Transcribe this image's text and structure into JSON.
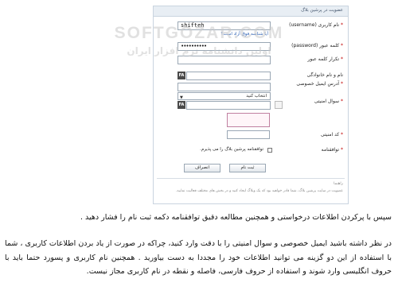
{
  "watermark": {
    "line1": "SOFTGOZAR.COM",
    "line2": "اولین دانشنامه نرم افزار ایران"
  },
  "form": {
    "title": "عضویت در پرشین بلاگ",
    "username_label": "نام کاربری (username)",
    "username_value": "shifteh",
    "availability_link": "آیا شناسه فوق آزاد است؟",
    "password_label": "کلمه عبور (password)",
    "password_value": "••••••••••",
    "repeat_password_label": "تکرار کلمه عبور",
    "fullname_label": "نام و نام خانوادگی",
    "email_label": "آدرس ایمیل خصوصی",
    "security_question_label": "سوال امنیتی",
    "security_question_selected": "انتخاب کنید",
    "security_answer_lang": "FA",
    "fullname_lang": "FA",
    "captcha_label": "کد امنیتی",
    "agreement_label": "توافقنامه",
    "agreement_text": "توافقنامه پرشین بلاگ را می پذیرم.",
    "submit_label": "ثبت نام",
    "cancel_label": "انصراف",
    "footer_heading": "راهنما",
    "footer_note": "عضویت در سایت پرشین بلاگ، شما قادر خواهید بود که یک وبلاگ ایجاد کنید و در بخش های مختلف فعالیت نمایید."
  },
  "article": {
    "para1": "سپس با پرکردن اطلاعات درخواستی و همچنین مطالعه دقیق توافقنامه دکمه ثبت نام را فشار دهید .",
    "para2": "در نظر داشته باشید ایمیل خصوصی و سوال امنیتی را با دقت وارد کنید، چراکه در صورت از یاد بردن اطلاعات کاربری ، شما با استفاده از این دو گزینه می توانید اطلاعات خود را مجددا به دست بیاورید . همچنین نام کاربری و پسورد حتما باید با حروف انگلیسی وارد شوند و استفاده از حروف فارسی، فاصله و نقطه در نام کاربری مجاز نیست."
  }
}
